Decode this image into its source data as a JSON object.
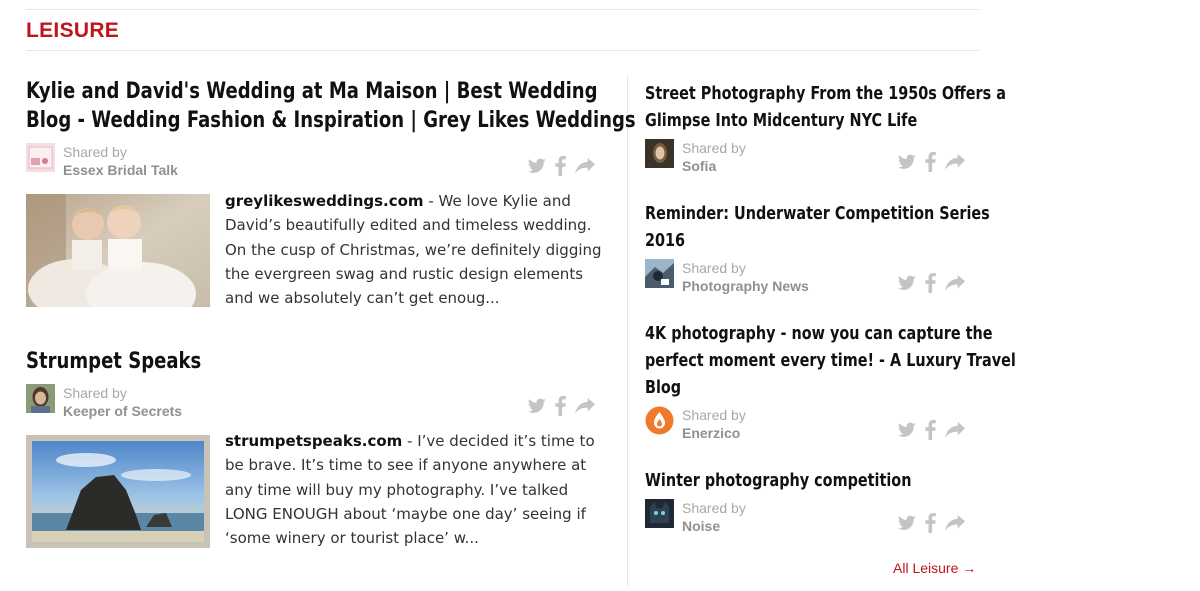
{
  "section": {
    "title": "LEISURE"
  },
  "left_articles": [
    {
      "title_lines": [
        "Kylie and David's Wedding at Ma Maison | Best Wedding",
        "Blog - Wedding Fashion & Inspiration | Grey Likes Weddings"
      ],
      "shared_by_label": "Shared by",
      "author": "Essex Bridal Talk",
      "source": "greylikesweddings.com",
      "excerpt": " - We love Kylie and David’s beautifully edited and timeless wedding. On the cusp of Christmas, we’re definitely digging the evergreen swag and rustic design elements and we absolutely can’t get enoug..."
    },
    {
      "title_lines": [
        "Strumpet Speaks"
      ],
      "shared_by_label": "Shared by",
      "author": "Keeper of Secrets",
      "source": "strumpetspeaks.com",
      "excerpt": " - I’ve decided it’s time to be brave. It’s time to see if anyone anywhere at any time will buy my photography. I’ve talked LONG ENOUGH about ‘maybe one day’ seeing if ‘some winery or tourist place’ w..."
    }
  ],
  "right_articles": [
    {
      "title_lines": [
        "Street Photography From the 1950s Offers a",
        "Glimpse Into Midcentury NYC Life"
      ],
      "shared_by_label": "Shared by",
      "author": "Sofia"
    },
    {
      "title_lines": [
        "Reminder: Underwater Competition Series",
        "2016"
      ],
      "shared_by_label": "Shared by",
      "author": "Photography News"
    },
    {
      "title_lines": [
        "4K photography - now you can capture the",
        "perfect moment every time! - A Luxury Travel",
        "Blog"
      ],
      "shared_by_label": "Shared by",
      "author": "Enerzico"
    },
    {
      "title_lines": [
        "Winter photography competition"
      ],
      "shared_by_label": "Shared by",
      "author": "Noise"
    }
  ],
  "footer": {
    "all_link": "All Leisure →"
  },
  "icons": [
    "twitter-icon",
    "facebook-icon",
    "share-arrow-icon"
  ],
  "colors": {
    "accent": "#c0141c",
    "icon": "#c4c4c4",
    "meta_gray": "#a8a8a8"
  }
}
